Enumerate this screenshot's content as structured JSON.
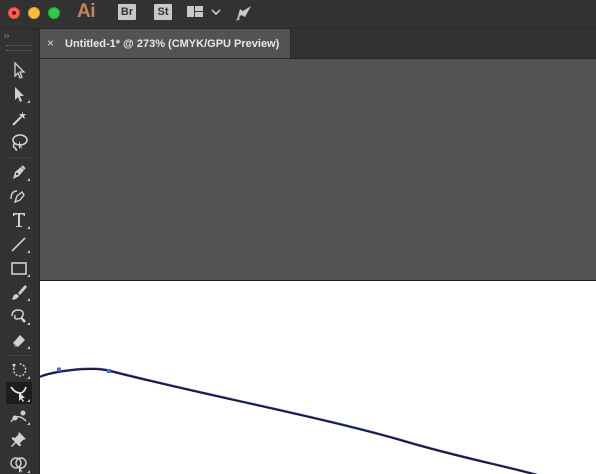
{
  "app": {
    "logo": "Ai",
    "bridge_badge": "Br",
    "stock_badge": "St",
    "icons": [
      "workspace-layout-icon",
      "chevron-down-icon",
      "rocket-icon"
    ]
  },
  "toolbar": {
    "collapse_glyph": "››",
    "tools": [
      {
        "name": "selection-tool",
        "icon": "arrow-outline-icon"
      },
      {
        "name": "direct-selection-tool",
        "icon": "arrow-filled-icon"
      },
      {
        "name": "magic-wand-tool",
        "icon": "magic-wand-icon"
      },
      {
        "name": "lasso-tool",
        "icon": "lasso-icon"
      },
      {
        "name": "pen-tool",
        "icon": "pen-icon"
      },
      {
        "name": "curvature-tool",
        "icon": "curvature-pen-icon"
      },
      {
        "name": "type-tool",
        "icon": "type-icon"
      },
      {
        "name": "line-segment-tool",
        "icon": "line-icon"
      },
      {
        "name": "rectangle-tool",
        "icon": "rectangle-icon"
      },
      {
        "name": "paintbrush-tool",
        "icon": "paintbrush-icon"
      },
      {
        "name": "shaper-tool",
        "icon": "shaper-icon"
      },
      {
        "name": "eraser-tool",
        "icon": "eraser-icon"
      },
      {
        "name": "rotate-tool",
        "icon": "rotate-icon"
      },
      {
        "name": "width-tool",
        "icon": "width-icon",
        "active": true
      },
      {
        "name": "puppet-warp-tool",
        "icon": "puppet-warp-icon"
      },
      {
        "name": "pin-tool",
        "icon": "pin-icon"
      },
      {
        "name": "shape-builder-tool",
        "icon": "shape-builder-icon"
      }
    ]
  },
  "document": {
    "tab_close_glyph": "×",
    "tab_title": "Untitled-1* @ 273% (CMYK/GPU Preview)"
  },
  "colors": {
    "chrome": "#323232",
    "pasteboard": "#535353",
    "artboard": "#ffffff",
    "path_stroke": "#1c1c3a",
    "selection_blue": "#4a6cf0"
  }
}
